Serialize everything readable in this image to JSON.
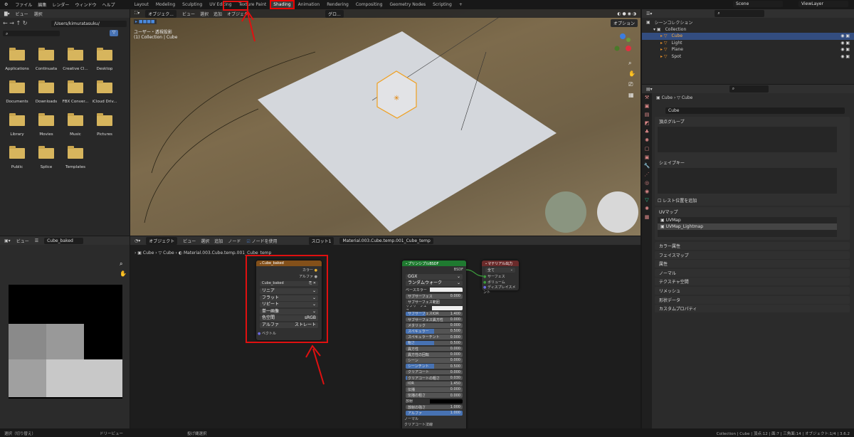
{
  "topbar": {
    "menus": [
      "ファイル",
      "編集",
      "レンダー",
      "ウィンドウ",
      "ヘルプ"
    ],
    "workspaces": [
      "Layout",
      "Modeling",
      "Sculpting",
      "UV Editing",
      "Texture Paint",
      "Shading",
      "Animation",
      "Rendering",
      "Compositing",
      "Geometry Nodes",
      "Scripting",
      "+"
    ],
    "active_workspace": "Shading",
    "scene": "Scene",
    "view_layer": "ViewLayer"
  },
  "file_browser": {
    "menus": [
      "ビュー",
      "選択"
    ],
    "path": "/Users/kimuratasuku/",
    "folders": [
      "Applications",
      "Continuata",
      "Creative Cl...",
      "Desktop",
      "Documents",
      "Downloads",
      "FBX Conver...",
      "iCloud Driv...",
      "Library",
      "Movies",
      "Music",
      "Pictures",
      "Public",
      "Splice",
      "Templates"
    ]
  },
  "viewport": {
    "mode": "オブジェク...",
    "menus": [
      "ビュー",
      "選択",
      "追加",
      "オブジェク"
    ],
    "transform": "グロ...",
    "view_label": "ユーザー・透視投影",
    "collection_label": "(1) Collection | Cube",
    "options": "オプション"
  },
  "outliner": {
    "root": "シーンコレクション",
    "collection": "Collection",
    "items": [
      "Cube",
      "Light",
      "Plane",
      "Spot"
    ],
    "selected": "Cube"
  },
  "properties": {
    "breadcrumb": [
      "Cube",
      "Cube"
    ],
    "mesh_name": "Cube",
    "panels_open": [
      "頂点グループ",
      "シェイプキー",
      "UVマップ"
    ],
    "rest_position": "レスト位置を追加",
    "uv_maps": [
      "UVMap",
      "UVMap_Lightmap"
    ],
    "panels_closed": [
      "カラー属性",
      "フェイスマップ",
      "属性",
      "ノーマル",
      "テクスチャ空間",
      "リメッシュ",
      "形状データ",
      "カスタムプロパティ"
    ]
  },
  "image_editor": {
    "menu": "ビュー",
    "image": "Cube_baked"
  },
  "node_editor": {
    "mode": "オブジェクト",
    "menus": [
      "ビュー",
      "選択",
      "追加",
      "ノード"
    ],
    "use_nodes": "ノードを使用",
    "slot": "スロット1",
    "material": "Material.003.Cube.temp.001_Cube_temp",
    "breadcrumb": [
      "Cube",
      "Cube",
      "Material.003.Cube.temp.001_Cube_temp"
    ]
  },
  "image_node": {
    "title": "Cube_baked",
    "outputs": [
      "カラー",
      "アルファ"
    ],
    "image": "Cube_baked",
    "dropdowns": [
      "リニア",
      "フラット",
      "リピート",
      "単一画像"
    ],
    "colorspace_label": "色空間",
    "colorspace": "sRGB",
    "alpha_label": "アルファ",
    "alpha": "ストレート",
    "input": "ベクトル"
  },
  "bsdf_node": {
    "title": "プリンシプルBSDF",
    "output": "BSDF",
    "distribution": "GGX",
    "subsurface_method": "ランダムウォーク",
    "base_color": "ベースカラー",
    "subsurface_radius": "サブサーフェス範囲",
    "subsurface_color": "サブサーフェス...",
    "emission": "放射",
    "normal": "ノーマル",
    "clearcoat_normal": "クリアコート法線",
    "fields": [
      {
        "label": "サブサーフェス",
        "value": "0.000",
        "fill": 0
      },
      {
        "label": "サブサーフェスIOR",
        "value": "1.400",
        "fill": 0.35
      },
      {
        "label": "サブサーフェス異方性",
        "value": "0.000",
        "fill": 0
      },
      {
        "label": "メタリック",
        "value": "0.000",
        "fill": 0
      },
      {
        "label": "スペキュラー",
        "value": "0.500",
        "fill": 0.5
      },
      {
        "label": "スペキュラーチント",
        "value": "0.000",
        "fill": 0
      },
      {
        "label": "粗さ",
        "value": "0.500",
        "fill": 0.5
      },
      {
        "label": "異方性",
        "value": "0.000",
        "fill": 0
      },
      {
        "label": "異方性の回転",
        "value": "0.000",
        "fill": 0
      },
      {
        "label": "シーン",
        "value": "0.000",
        "fill": 0
      },
      {
        "label": "シーンチント",
        "value": "0.500",
        "fill": 0.5
      },
      {
        "label": "クリアコート",
        "value": "0.000",
        "fill": 0
      },
      {
        "label": "クリアコートの粗さ",
        "value": "0.030",
        "fill": 0.03
      },
      {
        "label": "IOR",
        "value": "1.450",
        "fill": 0
      },
      {
        "label": "伝播",
        "value": "0.000",
        "fill": 0
      },
      {
        "label": "伝播の粗さ",
        "value": "0.000",
        "fill": 0
      }
    ],
    "fields2": [
      {
        "label": "放射の強さ",
        "value": "1.000",
        "fill": 0
      },
      {
        "label": "アルファ",
        "value": "1.000",
        "fill": 1
      }
    ]
  },
  "output_node": {
    "title": "マテリアル出力",
    "target": "全て",
    "inputs": [
      "サーフェス",
      "ボリューム",
      "ディスプレイスメント"
    ]
  },
  "status": {
    "left": [
      "選択（切り替え）",
      "ドリービュー",
      "投げ縄選択"
    ],
    "right": "Collection | Cube | 頂点:12 | 面:7 | 三角面:14 | オブジェクト:1/4 | 3.6.2"
  }
}
